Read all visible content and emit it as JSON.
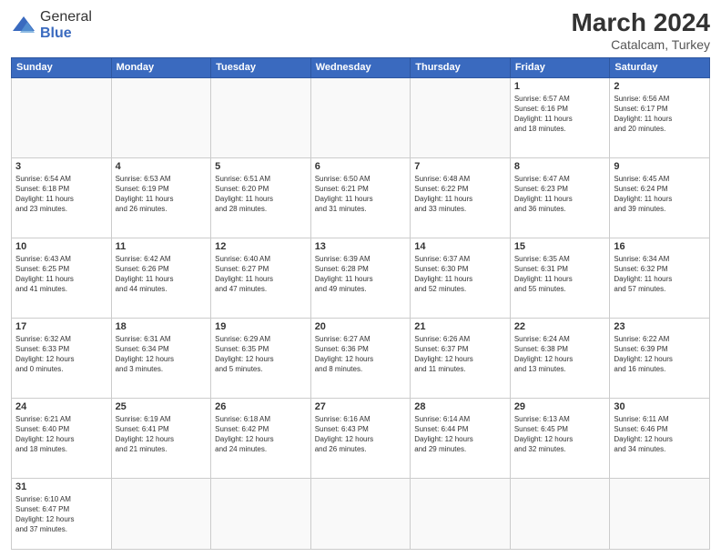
{
  "header": {
    "logo_general": "General",
    "logo_blue": "Blue",
    "title": "March 2024",
    "subtitle": "Catalcam, Turkey"
  },
  "days_of_week": [
    "Sunday",
    "Monday",
    "Tuesday",
    "Wednesday",
    "Thursday",
    "Friday",
    "Saturday"
  ],
  "weeks": [
    [
      {
        "day": "",
        "info": ""
      },
      {
        "day": "",
        "info": ""
      },
      {
        "day": "",
        "info": ""
      },
      {
        "day": "",
        "info": ""
      },
      {
        "day": "",
        "info": ""
      },
      {
        "day": "1",
        "info": "Sunrise: 6:57 AM\nSunset: 6:16 PM\nDaylight: 11 hours\nand 18 minutes."
      },
      {
        "day": "2",
        "info": "Sunrise: 6:56 AM\nSunset: 6:17 PM\nDaylight: 11 hours\nand 20 minutes."
      }
    ],
    [
      {
        "day": "3",
        "info": "Sunrise: 6:54 AM\nSunset: 6:18 PM\nDaylight: 11 hours\nand 23 minutes."
      },
      {
        "day": "4",
        "info": "Sunrise: 6:53 AM\nSunset: 6:19 PM\nDaylight: 11 hours\nand 26 minutes."
      },
      {
        "day": "5",
        "info": "Sunrise: 6:51 AM\nSunset: 6:20 PM\nDaylight: 11 hours\nand 28 minutes."
      },
      {
        "day": "6",
        "info": "Sunrise: 6:50 AM\nSunset: 6:21 PM\nDaylight: 11 hours\nand 31 minutes."
      },
      {
        "day": "7",
        "info": "Sunrise: 6:48 AM\nSunset: 6:22 PM\nDaylight: 11 hours\nand 33 minutes."
      },
      {
        "day": "8",
        "info": "Sunrise: 6:47 AM\nSunset: 6:23 PM\nDaylight: 11 hours\nand 36 minutes."
      },
      {
        "day": "9",
        "info": "Sunrise: 6:45 AM\nSunset: 6:24 PM\nDaylight: 11 hours\nand 39 minutes."
      }
    ],
    [
      {
        "day": "10",
        "info": "Sunrise: 6:43 AM\nSunset: 6:25 PM\nDaylight: 11 hours\nand 41 minutes."
      },
      {
        "day": "11",
        "info": "Sunrise: 6:42 AM\nSunset: 6:26 PM\nDaylight: 11 hours\nand 44 minutes."
      },
      {
        "day": "12",
        "info": "Sunrise: 6:40 AM\nSunset: 6:27 PM\nDaylight: 11 hours\nand 47 minutes."
      },
      {
        "day": "13",
        "info": "Sunrise: 6:39 AM\nSunset: 6:28 PM\nDaylight: 11 hours\nand 49 minutes."
      },
      {
        "day": "14",
        "info": "Sunrise: 6:37 AM\nSunset: 6:30 PM\nDaylight: 11 hours\nand 52 minutes."
      },
      {
        "day": "15",
        "info": "Sunrise: 6:35 AM\nSunset: 6:31 PM\nDaylight: 11 hours\nand 55 minutes."
      },
      {
        "day": "16",
        "info": "Sunrise: 6:34 AM\nSunset: 6:32 PM\nDaylight: 11 hours\nand 57 minutes."
      }
    ],
    [
      {
        "day": "17",
        "info": "Sunrise: 6:32 AM\nSunset: 6:33 PM\nDaylight: 12 hours\nand 0 minutes."
      },
      {
        "day": "18",
        "info": "Sunrise: 6:31 AM\nSunset: 6:34 PM\nDaylight: 12 hours\nand 3 minutes."
      },
      {
        "day": "19",
        "info": "Sunrise: 6:29 AM\nSunset: 6:35 PM\nDaylight: 12 hours\nand 5 minutes."
      },
      {
        "day": "20",
        "info": "Sunrise: 6:27 AM\nSunset: 6:36 PM\nDaylight: 12 hours\nand 8 minutes."
      },
      {
        "day": "21",
        "info": "Sunrise: 6:26 AM\nSunset: 6:37 PM\nDaylight: 12 hours\nand 11 minutes."
      },
      {
        "day": "22",
        "info": "Sunrise: 6:24 AM\nSunset: 6:38 PM\nDaylight: 12 hours\nand 13 minutes."
      },
      {
        "day": "23",
        "info": "Sunrise: 6:22 AM\nSunset: 6:39 PM\nDaylight: 12 hours\nand 16 minutes."
      }
    ],
    [
      {
        "day": "24",
        "info": "Sunrise: 6:21 AM\nSunset: 6:40 PM\nDaylight: 12 hours\nand 18 minutes."
      },
      {
        "day": "25",
        "info": "Sunrise: 6:19 AM\nSunset: 6:41 PM\nDaylight: 12 hours\nand 21 minutes."
      },
      {
        "day": "26",
        "info": "Sunrise: 6:18 AM\nSunset: 6:42 PM\nDaylight: 12 hours\nand 24 minutes."
      },
      {
        "day": "27",
        "info": "Sunrise: 6:16 AM\nSunset: 6:43 PM\nDaylight: 12 hours\nand 26 minutes."
      },
      {
        "day": "28",
        "info": "Sunrise: 6:14 AM\nSunset: 6:44 PM\nDaylight: 12 hours\nand 29 minutes."
      },
      {
        "day": "29",
        "info": "Sunrise: 6:13 AM\nSunset: 6:45 PM\nDaylight: 12 hours\nand 32 minutes."
      },
      {
        "day": "30",
        "info": "Sunrise: 6:11 AM\nSunset: 6:46 PM\nDaylight: 12 hours\nand 34 minutes."
      }
    ],
    [
      {
        "day": "31",
        "info": "Sunrise: 6:10 AM\nSunset: 6:47 PM\nDaylight: 12 hours\nand 37 minutes."
      },
      {
        "day": "",
        "info": ""
      },
      {
        "day": "",
        "info": ""
      },
      {
        "day": "",
        "info": ""
      },
      {
        "day": "",
        "info": ""
      },
      {
        "day": "",
        "info": ""
      },
      {
        "day": "",
        "info": ""
      }
    ]
  ]
}
